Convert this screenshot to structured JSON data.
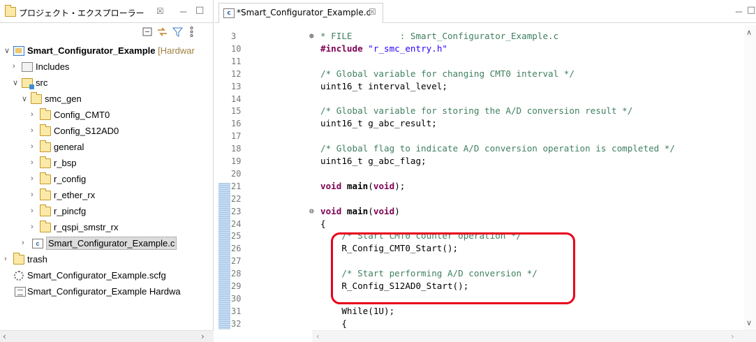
{
  "explorer": {
    "title": "プロジェクト・エクスプローラー",
    "close_glyph": "☒",
    "minimize_glyph": "－",
    "maximize_glyph": "□",
    "tree": [
      {
        "label": "Smart_Configurator_Example",
        "decoration": "[Hardwar",
        "expanded": true,
        "icon": "project-icon"
      },
      {
        "label": "Includes",
        "icon": "includes-icon"
      },
      {
        "label": "src",
        "icon": "source-folder-icon"
      },
      {
        "label": "smc_gen",
        "icon": "folder-icon"
      },
      {
        "label": "Config_CMT0",
        "icon": "folder-icon"
      },
      {
        "label": "Config_S12AD0",
        "icon": "folder-icon"
      },
      {
        "label": "general",
        "icon": "folder-icon"
      },
      {
        "label": "r_bsp",
        "icon": "folder-icon"
      },
      {
        "label": "r_config",
        "icon": "folder-icon"
      },
      {
        "label": "r_ether_rx",
        "icon": "folder-icon"
      },
      {
        "label": "r_pincfg",
        "icon": "folder-icon"
      },
      {
        "label": "r_qspi_smstr_rx",
        "icon": "folder-icon"
      },
      {
        "label": "Smart_Configurator_Example.c",
        "icon": "c-file-icon",
        "selected": true
      },
      {
        "label": "trash",
        "icon": "folder-icon"
      },
      {
        "label": "Smart_Configurator_Example.scfg",
        "icon": "gear-icon"
      },
      {
        "label": "Smart_Configurator_Example Hardwa",
        "icon": "document-icon"
      }
    ]
  },
  "editor": {
    "tab_title": "*Smart_Configurator_Example.c",
    "close_glyph": "☒",
    "lines": [
      {
        "n": "3",
        "text": "* FILE         : Smart_Configurator_Example.c",
        "type": "cm",
        "fold": "⊕"
      },
      {
        "n": "10",
        "pre": "#include ",
        "str": "\"r_smc_entry.h\"",
        "type": "inc"
      },
      {
        "n": "11",
        "text": "",
        "type": "pl"
      },
      {
        "n": "12",
        "text": "/* Global variable for changing CMT0 interval */",
        "type": "cm"
      },
      {
        "n": "13",
        "text": "uint16_t interval_level;",
        "type": "pl"
      },
      {
        "n": "14",
        "text": "",
        "type": "pl"
      },
      {
        "n": "15",
        "text": "/* Global variable for storing the A/D conversion result */",
        "type": "cm"
      },
      {
        "n": "16",
        "text": "uint16_t g_abc_result;",
        "type": "pl"
      },
      {
        "n": "17",
        "text": "",
        "type": "pl"
      },
      {
        "n": "18",
        "text": "/* Global flag to indicate A/D conversion operation is completed */",
        "type": "cm"
      },
      {
        "n": "19",
        "text": "uint16_t g_abc_flag;",
        "type": "pl"
      },
      {
        "n": "20",
        "text": "",
        "type": "pl"
      },
      {
        "n": "21",
        "kw1": "void",
        "fnname": " main",
        "kw2": "void",
        "tail": ");",
        "type": "decl"
      },
      {
        "n": "22",
        "text": "",
        "type": "pl"
      },
      {
        "n": "23",
        "kw1": "void",
        "fnname": " main",
        "kw2": "void",
        "tail": ")",
        "type": "decl",
        "fold": "⊖"
      },
      {
        "n": "24",
        "text": "{",
        "type": "pl"
      },
      {
        "n": "25",
        "text": "    /* Start CMT0 counter operation */",
        "type": "cm"
      },
      {
        "n": "26",
        "text": "    R_Config_CMT0_Start();",
        "type": "pl"
      },
      {
        "n": "27",
        "text": "",
        "type": "pl"
      },
      {
        "n": "28",
        "text": "    /* Start performing A/D conversion */",
        "type": "cm"
      },
      {
        "n": "29",
        "text": "    R_Config_S12AD0_Start();",
        "type": "pl"
      },
      {
        "n": "30",
        "text": "",
        "type": "pl"
      },
      {
        "n": "31",
        "text": "    While(1U);",
        "type": "pl"
      },
      {
        "n": "32",
        "text": "    {",
        "type": "pl"
      }
    ]
  },
  "colors": {
    "highlight_border": "#e8001c",
    "keyword": "#7f0055",
    "comment": "#3f7f5f",
    "string": "#2a00ff"
  }
}
